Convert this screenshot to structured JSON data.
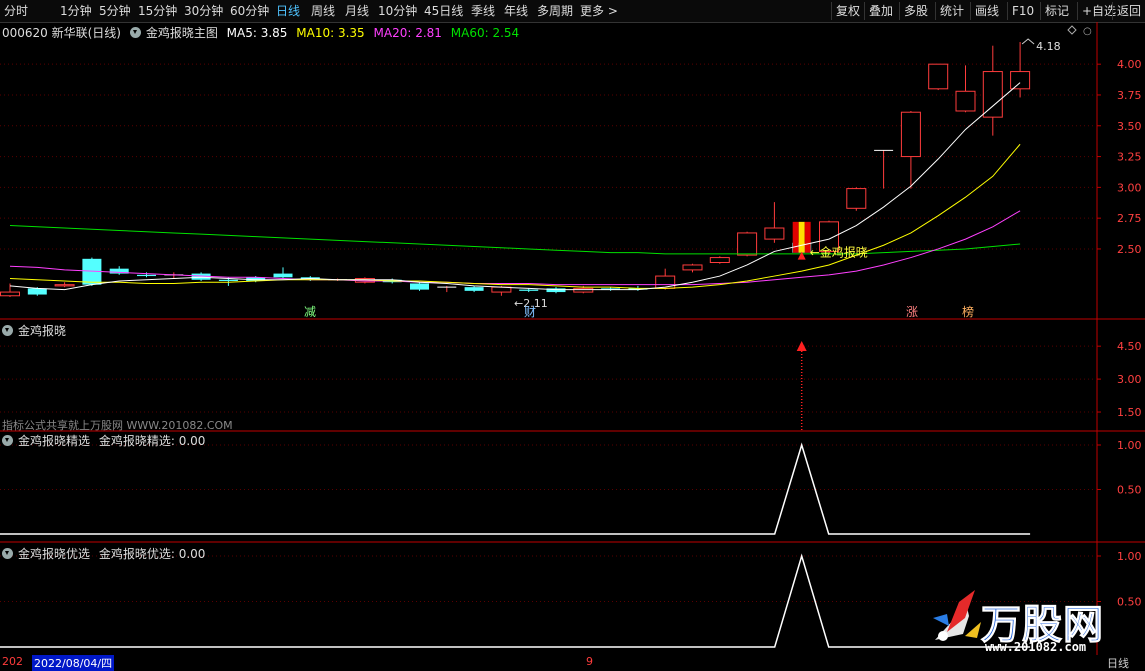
{
  "toolbar": {
    "periods": [
      "分时",
      "1分钟",
      "5分钟",
      "15分钟",
      "30分钟",
      "60分钟",
      "日线",
      "周线",
      "月线",
      "10分钟",
      "45日线",
      "季线",
      "年线",
      "多周期",
      "更多 >"
    ],
    "active": "日线",
    "tools": [
      "复权",
      "叠加",
      "多股",
      "统计",
      "画线",
      "F10",
      "标记",
      "+自选",
      "返回"
    ]
  },
  "main_header": {
    "stock": "000620 新华联(日线)",
    "indicator": "金鸡报晓主图",
    "ma5": "MA5: 3.85",
    "ma10": "MA10: 3.35",
    "ma20": "MA20: 2.81",
    "ma60": "MA60: 2.54"
  },
  "price_axis": [
    "4.00",
    "3.75",
    "3.50",
    "3.25",
    "3.00",
    "2.75",
    "2.50"
  ],
  "annotations": {
    "high_label": "4.18",
    "low_label": "2.11",
    "signal_label": "金鸡报晓",
    "marks": [
      "减",
      "财",
      "涨",
      "榜"
    ]
  },
  "panel2": {
    "title": "金鸡报晓",
    "axis": [
      "4.50",
      "3.00",
      "1.50"
    ],
    "watermark": "指标公式共享就上万股网 WWW.201082.COM"
  },
  "panel3": {
    "title": "金鸡报晓精选",
    "value_text": "金鸡报晓精选: 0.00",
    "axis": [
      "1.00",
      "0.50"
    ]
  },
  "panel4": {
    "title": "金鸡报晓优选",
    "value_text": "金鸡报晓优选: 0.00",
    "axis": [
      "1.00",
      "0.50"
    ]
  },
  "status": {
    "date_prefix": "202",
    "date": "2022/08/04/四",
    "marker": "9",
    "period_label": "日线"
  },
  "logo": {
    "brand": "万股网",
    "url": "www.201082.com"
  },
  "colors": {
    "up": "#ff3c3c",
    "down": "#54ffff",
    "ma5": "#ffffff",
    "ma10": "#ffff00",
    "ma20": "#ff40ff",
    "ma60": "#00e000",
    "grid": "#5a0000",
    "axis": "#c00000"
  },
  "chart_data": {
    "type": "candlestick",
    "price_range": [
      2.11,
      4.18
    ],
    "candles": [
      {
        "o": 2.12,
        "c": 2.15,
        "h": 2.22,
        "l": 2.11
      },
      {
        "o": 2.18,
        "c": 2.13,
        "h": 2.19,
        "l": 2.12
      },
      {
        "o": 2.2,
        "c": 2.21,
        "h": 2.23,
        "l": 2.19
      },
      {
        "o": 2.42,
        "c": 2.21,
        "h": 2.43,
        "l": 2.2
      },
      {
        "o": 2.34,
        "c": 2.3,
        "h": 2.36,
        "l": 2.29
      },
      {
        "o": 2.29,
        "c": 2.28,
        "h": 2.31,
        "l": 2.27
      },
      {
        "o": 2.29,
        "c": 2.29,
        "h": 2.31,
        "l": 2.26
      },
      {
        "o": 2.3,
        "c": 2.25,
        "h": 2.31,
        "l": 2.24
      },
      {
        "o": 2.25,
        "c": 2.24,
        "h": 2.27,
        "l": 2.2
      },
      {
        "o": 2.27,
        "c": 2.24,
        "h": 2.28,
        "l": 2.23
      },
      {
        "o": 2.3,
        "c": 2.27,
        "h": 2.35,
        "l": 2.26
      },
      {
        "o": 2.27,
        "c": 2.25,
        "h": 2.28,
        "l": 2.24
      },
      {
        "o": 2.25,
        "c": 2.25,
        "h": 2.26,
        "l": 2.24
      },
      {
        "o": 2.23,
        "c": 2.26,
        "h": 2.27,
        "l": 2.22
      },
      {
        "o": 2.25,
        "c": 2.23,
        "h": 2.26,
        "l": 2.22
      },
      {
        "o": 2.22,
        "c": 2.17,
        "h": 2.23,
        "l": 2.16
      },
      {
        "o": 2.19,
        "c": 2.19,
        "h": 2.2,
        "l": 2.15
      },
      {
        "o": 2.19,
        "c": 2.16,
        "h": 2.2,
        "l": 2.15
      },
      {
        "o": 2.15,
        "c": 2.19,
        "h": 2.2,
        "l": 2.12
      },
      {
        "o": 2.17,
        "c": 2.16,
        "h": 2.18,
        "l": 2.15
      },
      {
        "o": 2.18,
        "c": 2.15,
        "h": 2.19,
        "l": 2.14
      },
      {
        "o": 2.15,
        "c": 2.18,
        "h": 2.2,
        "l": 2.14
      },
      {
        "o": 2.18,
        "c": 2.17,
        "h": 2.19,
        "l": 2.16
      },
      {
        "o": 2.18,
        "c": 2.17,
        "h": 2.2,
        "l": 2.16
      },
      {
        "o": 2.18,
        "c": 2.28,
        "h": 2.34,
        "l": 2.17
      },
      {
        "o": 2.33,
        "c": 2.37,
        "h": 2.38,
        "l": 2.31
      },
      {
        "o": 2.39,
        "c": 2.43,
        "h": 2.44,
        "l": 2.38
      },
      {
        "o": 2.45,
        "c": 2.63,
        "h": 2.64,
        "l": 2.44
      },
      {
        "o": 2.58,
        "c": 2.67,
        "h": 2.88,
        "l": 2.55
      },
      {
        "o": 2.55,
        "c": 2.47,
        "h": 2.62,
        "l": 2.46
      },
      {
        "o": 2.48,
        "c": 2.72,
        "h": 2.73,
        "l": 2.46
      },
      {
        "o": 2.83,
        "c": 2.99,
        "h": 3.0,
        "l": 2.81
      },
      {
        "o": 3.3,
        "c": 3.3,
        "h": 3.3,
        "l": 2.99
      },
      {
        "o": 3.25,
        "c": 3.61,
        "h": 3.62,
        "l": 2.99
      },
      {
        "o": 3.8,
        "c": 4.0,
        "h": 4.0,
        "l": 3.79
      },
      {
        "o": 3.62,
        "c": 3.78,
        "h": 3.99,
        "l": 3.61
      },
      {
        "o": 3.57,
        "c": 3.94,
        "h": 4.15,
        "l": 3.42
      },
      {
        "o": 3.8,
        "c": 3.94,
        "h": 4.18,
        "l": 3.73
      }
    ],
    "ma5": [
      2.2,
      2.18,
      2.17,
      2.21,
      2.24,
      2.25,
      2.26,
      2.27,
      2.26,
      2.25,
      2.25,
      2.26,
      2.25,
      2.25,
      2.25,
      2.23,
      2.22,
      2.2,
      2.19,
      2.18,
      2.17,
      2.17,
      2.17,
      2.17,
      2.19,
      2.23,
      2.28,
      2.37,
      2.48,
      2.53,
      2.58,
      2.69,
      2.84,
      3.01,
      3.23,
      3.47,
      3.66,
      3.85
    ],
    "ma10": [
      2.26,
      2.25,
      2.24,
      2.23,
      2.23,
      2.22,
      2.22,
      2.23,
      2.23,
      2.24,
      2.25,
      2.25,
      2.25,
      2.25,
      2.24,
      2.24,
      2.23,
      2.22,
      2.21,
      2.21,
      2.2,
      2.19,
      2.19,
      2.18,
      2.18,
      2.19,
      2.21,
      2.24,
      2.28,
      2.32,
      2.37,
      2.45,
      2.53,
      2.63,
      2.77,
      2.92,
      3.09,
      3.35
    ],
    "ma20": [
      2.36,
      2.35,
      2.33,
      2.32,
      2.31,
      2.3,
      2.29,
      2.28,
      2.27,
      2.27,
      2.26,
      2.25,
      2.25,
      2.24,
      2.24,
      2.23,
      2.23,
      2.22,
      2.22,
      2.22,
      2.21,
      2.21,
      2.21,
      2.21,
      2.21,
      2.21,
      2.22,
      2.23,
      2.25,
      2.27,
      2.29,
      2.32,
      2.37,
      2.43,
      2.5,
      2.58,
      2.68,
      2.81
    ],
    "ma60": [
      2.69,
      2.68,
      2.67,
      2.66,
      2.65,
      2.64,
      2.63,
      2.62,
      2.61,
      2.6,
      2.59,
      2.58,
      2.57,
      2.56,
      2.55,
      2.54,
      2.53,
      2.52,
      2.51,
      2.5,
      2.49,
      2.48,
      2.47,
      2.47,
      2.46,
      2.46,
      2.46,
      2.46,
      2.46,
      2.46,
      2.46,
      2.46,
      2.47,
      2.48,
      2.49,
      2.5,
      2.52,
      2.54
    ],
    "signal_index": 29,
    "spike_index": 29
  }
}
